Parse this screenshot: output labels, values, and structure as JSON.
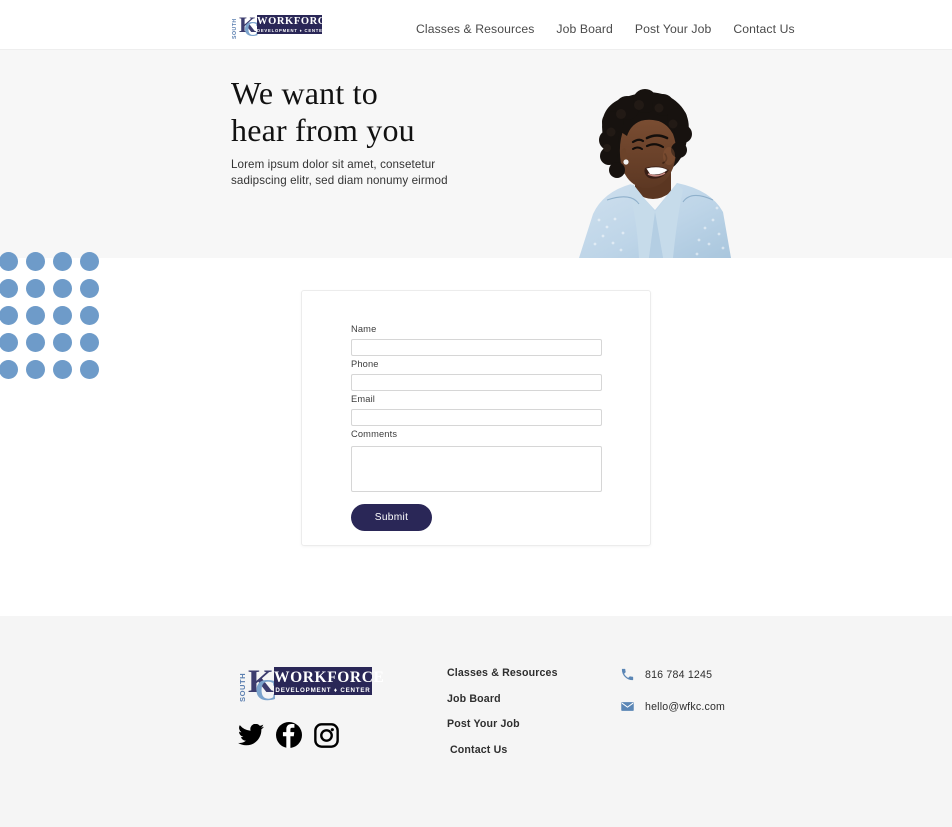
{
  "brand": {
    "south": "SOUTH",
    "word": "WORKFORCE",
    "sub": "DEVELOPMENT&nbsp;&#9830;&nbsp;CENTER",
    "mono_k": "K",
    "mono_c": "C",
    "navy": "#2a2757",
    "blue": "#7ba3cc"
  },
  "header": {
    "nav": [
      {
        "label": "Classes & Resources"
      },
      {
        "label": "Job Board"
      },
      {
        "label": "Post Your Job"
      },
      {
        "label": "Contact Us"
      }
    ]
  },
  "hero": {
    "title_line1": "We want to",
    "title_line2": "hear from you",
    "sub_line1": "Lorem ipsum dolor sit amet, consetetur",
    "sub_line2": "sadipscing elitr, sed diam nonumy eirmod",
    "photo_alt": "smiling-woman-photo",
    "bg_color": "#f7f7f7"
  },
  "decor": {
    "dots_color": "#6e9bc9",
    "dots_rows": 5,
    "dots_cols": 5
  },
  "form": {
    "fields": [
      {
        "label": "Name",
        "value": "",
        "placeholder": "",
        "name": "name-input"
      },
      {
        "label": "Phone",
        "value": "",
        "placeholder": "",
        "name": "phone-input"
      },
      {
        "label": "Email",
        "value": "",
        "placeholder": "",
        "name": "email-input"
      }
    ],
    "comments_label": "Comments",
    "comments_value": "",
    "comments_placeholder": "",
    "submit_label": "Submit",
    "submit_color": "#2a2757"
  },
  "footer": {
    "bg_color": "#f5f5f5",
    "links": [
      {
        "label": "Classes & Resources"
      },
      {
        "label": "Job Board"
      },
      {
        "label": "Post Your Job"
      },
      {
        "label": "Contact Us"
      }
    ],
    "phone": "816 784 1245",
    "email": "hello@wfkc.com",
    "icon_color": "#5b86b5",
    "socials": [
      {
        "name": "twitter-icon"
      },
      {
        "name": "facebook-icon"
      },
      {
        "name": "instagram-icon"
      }
    ]
  }
}
